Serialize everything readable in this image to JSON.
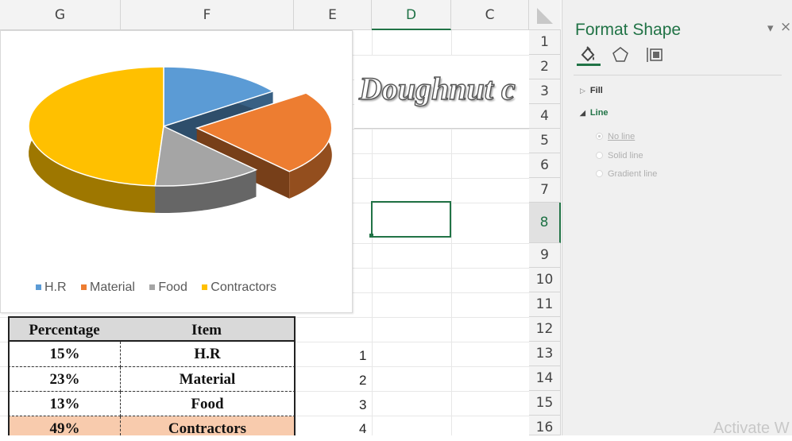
{
  "spreadsheet": {
    "columns": [
      "G",
      "F",
      "E",
      "D",
      "C"
    ],
    "rows": [
      "1",
      "2",
      "3",
      "4",
      "5",
      "6",
      "7",
      "8",
      "9",
      "10",
      "11",
      "12",
      "13",
      "14",
      "15",
      "16"
    ],
    "active_column": "D",
    "active_row": "8",
    "doughnut_heading": "Doughnut c",
    "index_numbers": [
      "1",
      "2",
      "3",
      "4"
    ]
  },
  "chart": {
    "legend": [
      "H.R",
      "Material",
      "Food",
      "Contractors"
    ]
  },
  "chart_data": {
    "type": "pie",
    "categories": [
      "H.R",
      "Material",
      "Food",
      "Contractors"
    ],
    "values": [
      15,
      23,
      13,
      49
    ],
    "colors": [
      "#5b9bd5",
      "#ed7d31",
      "#a5a5a5",
      "#ffc000"
    ],
    "legend_position": "bottom-left",
    "exploded": "Material"
  },
  "table": {
    "headers": [
      "Percentage",
      "Item"
    ],
    "rows": [
      {
        "pct": "15%",
        "item": "H.R"
      },
      {
        "pct": "23%",
        "item": "Material"
      },
      {
        "pct": "13%",
        "item": "Food"
      },
      {
        "pct": "49%",
        "item": "Contractors"
      }
    ],
    "highlight_color": "#f8cbad"
  },
  "pane": {
    "title": "Format Shape",
    "icons": [
      "fill-line-icon",
      "effects-icon",
      "size-properties-icon"
    ],
    "sections": {
      "fill": "Fill",
      "line": "Line"
    },
    "line_options": [
      "No line",
      "Solid line",
      "Gradient line"
    ],
    "close_glyph": "×",
    "dropdown_glyph": "▾"
  },
  "watermark": "Activate W",
  "colors": {
    "accent": "#217346"
  }
}
